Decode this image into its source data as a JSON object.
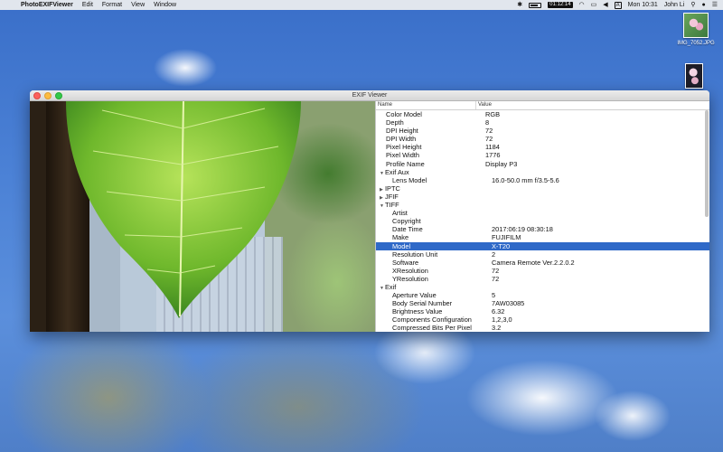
{
  "menubar": {
    "app_name": "PhotoEXIFViewer",
    "menus": [
      "Edit",
      "Format",
      "View",
      "Window"
    ],
    "battery_time": "01:12:14",
    "clock": "Mon 10:31",
    "user": "John Li",
    "input_source": "A"
  },
  "desktop": {
    "icons": [
      {
        "label": "IMG_7052.JPG",
        "icon": "photo-file-icon"
      },
      {
        "label": "",
        "icon": "photo-file-icon"
      }
    ]
  },
  "window": {
    "title": "EXIF Viewer"
  },
  "table": {
    "columns": {
      "name": "Name",
      "value": "Value"
    },
    "rows": [
      {
        "name": "Color Model",
        "value": "RGB",
        "indent": 1,
        "type": "leaf"
      },
      {
        "name": "Depth",
        "value": "8",
        "indent": 1,
        "type": "leaf"
      },
      {
        "name": "DPI Height",
        "value": "72",
        "indent": 1,
        "type": "leaf"
      },
      {
        "name": "DPI Width",
        "value": "72",
        "indent": 1,
        "type": "leaf"
      },
      {
        "name": "Pixel Height",
        "value": "1184",
        "indent": 1,
        "type": "leaf"
      },
      {
        "name": "Pixel Width",
        "value": "1776",
        "indent": 1,
        "type": "leaf"
      },
      {
        "name": "Profile Name",
        "value": "Display P3",
        "indent": 1,
        "type": "leaf"
      },
      {
        "name": "Exif Aux",
        "value": "",
        "indent": 0,
        "type": "expanded"
      },
      {
        "name": "Lens Model",
        "value": "16.0-50.0 mm f/3.5-5.6",
        "indent": 2,
        "type": "leaf"
      },
      {
        "name": "IPTC",
        "value": "",
        "indent": 0,
        "type": "collapsed"
      },
      {
        "name": "JFIF",
        "value": "",
        "indent": 0,
        "type": "collapsed"
      },
      {
        "name": "TIFF",
        "value": "",
        "indent": 0,
        "type": "expanded"
      },
      {
        "name": "Artist",
        "value": "",
        "indent": 2,
        "type": "leaf"
      },
      {
        "name": "Copyright",
        "value": "",
        "indent": 2,
        "type": "leaf"
      },
      {
        "name": "Date Time",
        "value": "2017:06:19 08:30:18",
        "indent": 2,
        "type": "leaf"
      },
      {
        "name": "Make",
        "value": "FUJIFILM",
        "indent": 2,
        "type": "leaf"
      },
      {
        "name": "Model",
        "value": "X-T20",
        "indent": 2,
        "type": "leaf",
        "selected": true
      },
      {
        "name": "Resolution Unit",
        "value": "2",
        "indent": 2,
        "type": "leaf"
      },
      {
        "name": "Software",
        "value": "Camera Remote Ver.2.2.0.2",
        "indent": 2,
        "type": "leaf"
      },
      {
        "name": "XResolution",
        "value": "72",
        "indent": 2,
        "type": "leaf"
      },
      {
        "name": "YResolution",
        "value": "72",
        "indent": 2,
        "type": "leaf"
      },
      {
        "name": "Exif",
        "value": "",
        "indent": 0,
        "type": "expanded"
      },
      {
        "name": "Aperture Value",
        "value": "5",
        "indent": 2,
        "type": "leaf"
      },
      {
        "name": "Body Serial Number",
        "value": "7AW03085",
        "indent": 2,
        "type": "leaf"
      },
      {
        "name": "Brightness Value",
        "value": "6.32",
        "indent": 2,
        "type": "leaf"
      },
      {
        "name": "Components Configuration",
        "value": "1,2,3,0",
        "indent": 2,
        "type": "leaf"
      },
      {
        "name": "Compressed Bits Per Pixel",
        "value": "3.2",
        "indent": 2,
        "type": "leaf"
      }
    ]
  },
  "colors": {
    "selection": "#2f69c8",
    "desktop": "#4c82d6"
  }
}
